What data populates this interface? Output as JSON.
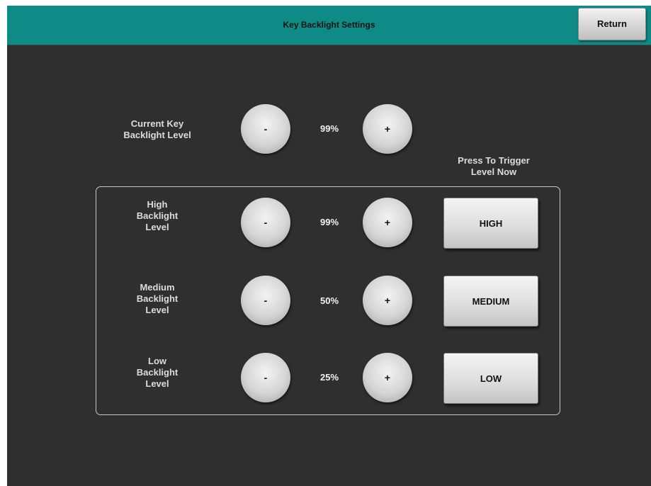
{
  "header": {
    "title": "Key Backlight Settings",
    "return_label": "Return"
  },
  "current": {
    "label_line1": "Current Key",
    "label_line2": "Backlight Level",
    "value": "99%",
    "minus": "-",
    "plus": "+"
  },
  "trigger_header": {
    "line1": "Press To Trigger",
    "line2": "Level Now"
  },
  "levels": [
    {
      "label_line1": "High",
      "label_line2": "Backlight",
      "label_line3": "Level",
      "value": "99%",
      "minus": "-",
      "plus": "+",
      "trigger": "HIGH"
    },
    {
      "label_line1": "Medium",
      "label_line2": "Backlight",
      "label_line3": "Level",
      "value": "50%",
      "minus": "-",
      "plus": "+",
      "trigger": "MEDIUM"
    },
    {
      "label_line1": "Low",
      "label_line2": "Backlight",
      "label_line3": "Level",
      "value": "25%",
      "minus": "-",
      "plus": "+",
      "trigger": "LOW"
    }
  ]
}
